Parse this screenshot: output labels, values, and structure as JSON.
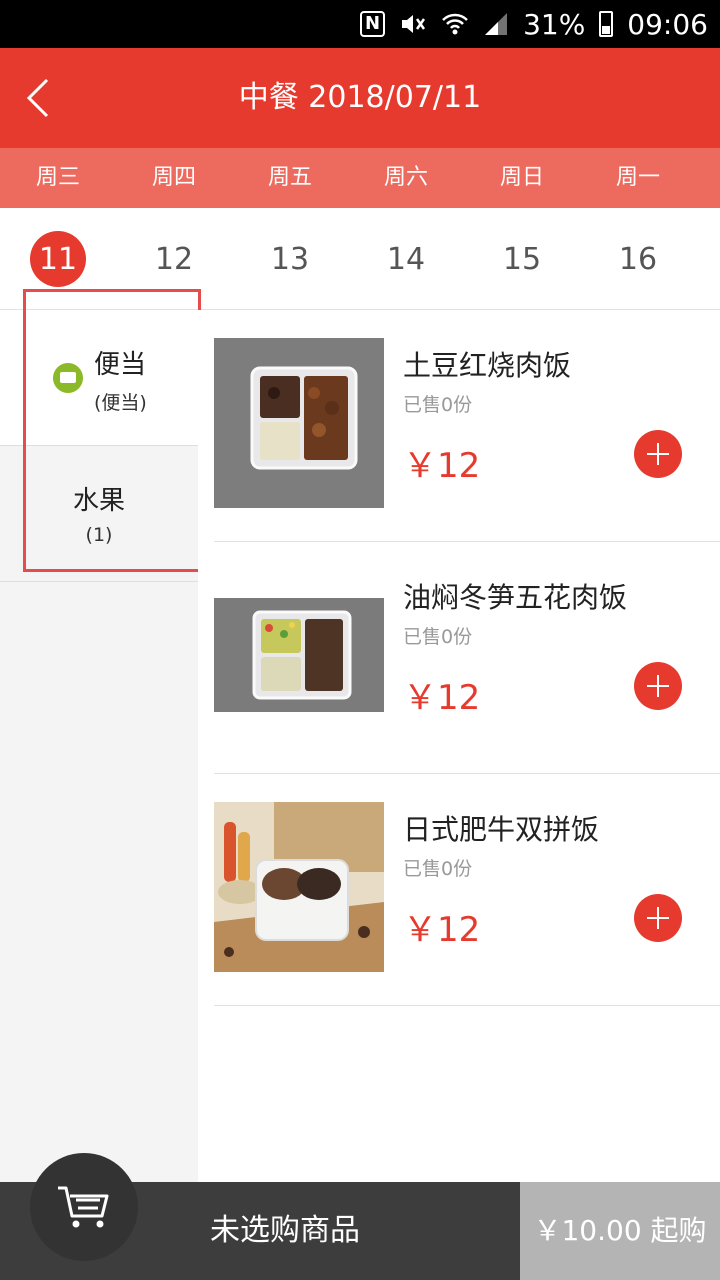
{
  "status_bar": {
    "nfc": "N",
    "battery": "31%",
    "time": "09:06"
  },
  "header": {
    "title": "中餐 2018/07/11"
  },
  "weekdays": [
    "周三",
    "周四",
    "周五",
    "周六",
    "周日",
    "周一"
  ],
  "dates": [
    "11",
    "12",
    "13",
    "14",
    "15",
    "16"
  ],
  "selected_date_index": 0,
  "categories": [
    {
      "name": "便当",
      "sub": "(便当)"
    },
    {
      "name": "水果",
      "sub": "(1)"
    }
  ],
  "products": [
    {
      "name": "土豆红烧肉饭",
      "sold": "已售0份",
      "price": "￥12"
    },
    {
      "name": "油焖冬笋五花肉饭",
      "sold": "已售0份",
      "price": "￥12"
    },
    {
      "name": "日式肥牛双拼饭",
      "sold": "已售0份",
      "price": "￥12"
    }
  ],
  "cart": {
    "label": "未选购商品",
    "checkout": "￥10.00 起购"
  },
  "colors": {
    "accent": "#e63a2e",
    "weekday_bar": "#ec6a5e",
    "category_icon": "#8bb927",
    "bottom_bar": "#3d3d3d"
  }
}
